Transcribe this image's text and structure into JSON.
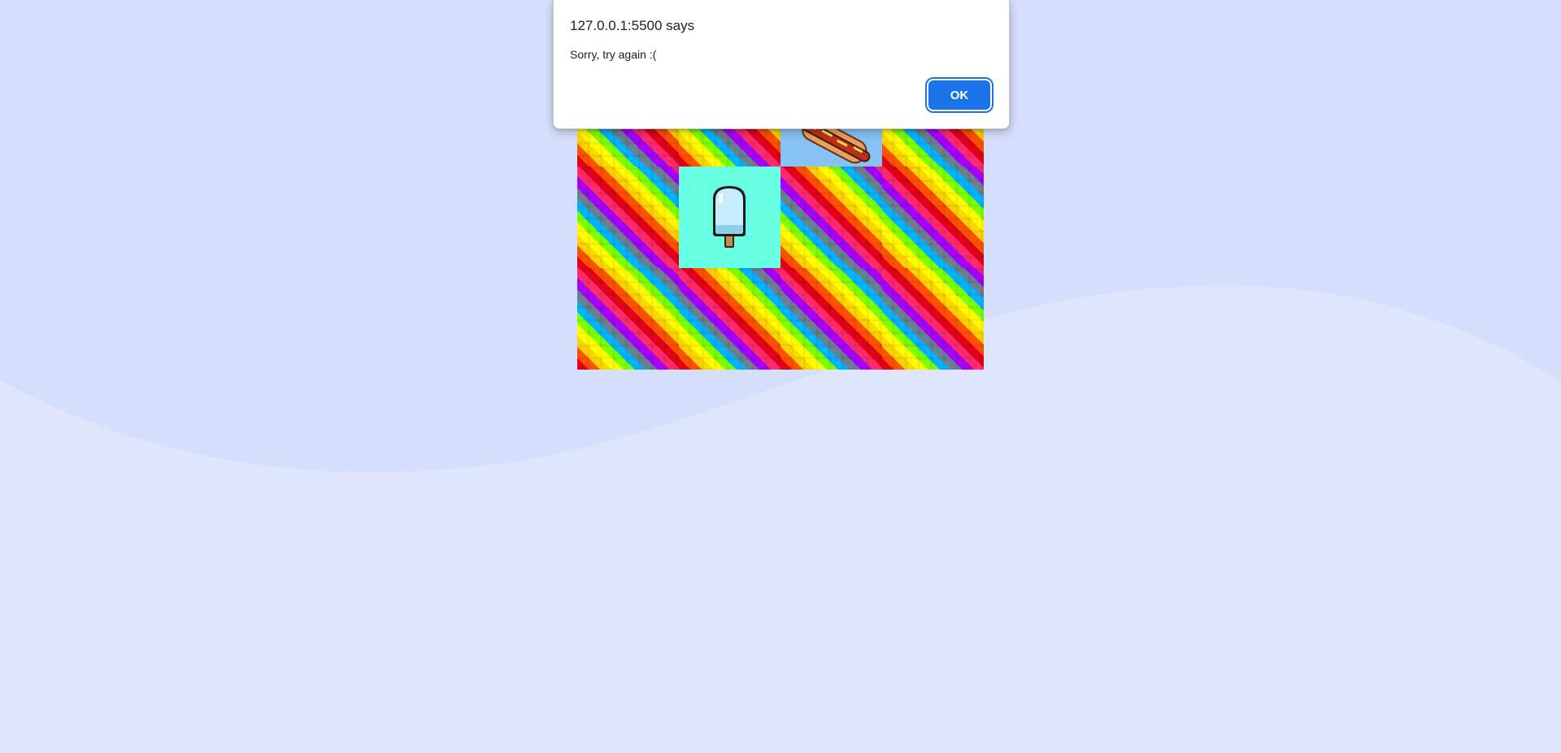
{
  "dialog": {
    "title": "127.0.0.1:5500 says",
    "message": "Sorry, try again :(",
    "ok_label": "OK"
  },
  "board": {
    "rows": 3,
    "columns": 4,
    "revealed_cards": [
      {
        "row": 1,
        "column": 3,
        "item": "hotdog"
      },
      {
        "row": 2,
        "column": 2,
        "item": "popsicle"
      }
    ]
  },
  "colors": {
    "page_background": "#dfe5fd",
    "wave": "#d4dffc",
    "hotdog_card_bg": "#87c2f5",
    "popsicle_card_bg": "#66ffe3",
    "ok_button": "#1a73e8"
  },
  "icons": [
    "hotdog-icon",
    "popsicle-icon"
  ]
}
